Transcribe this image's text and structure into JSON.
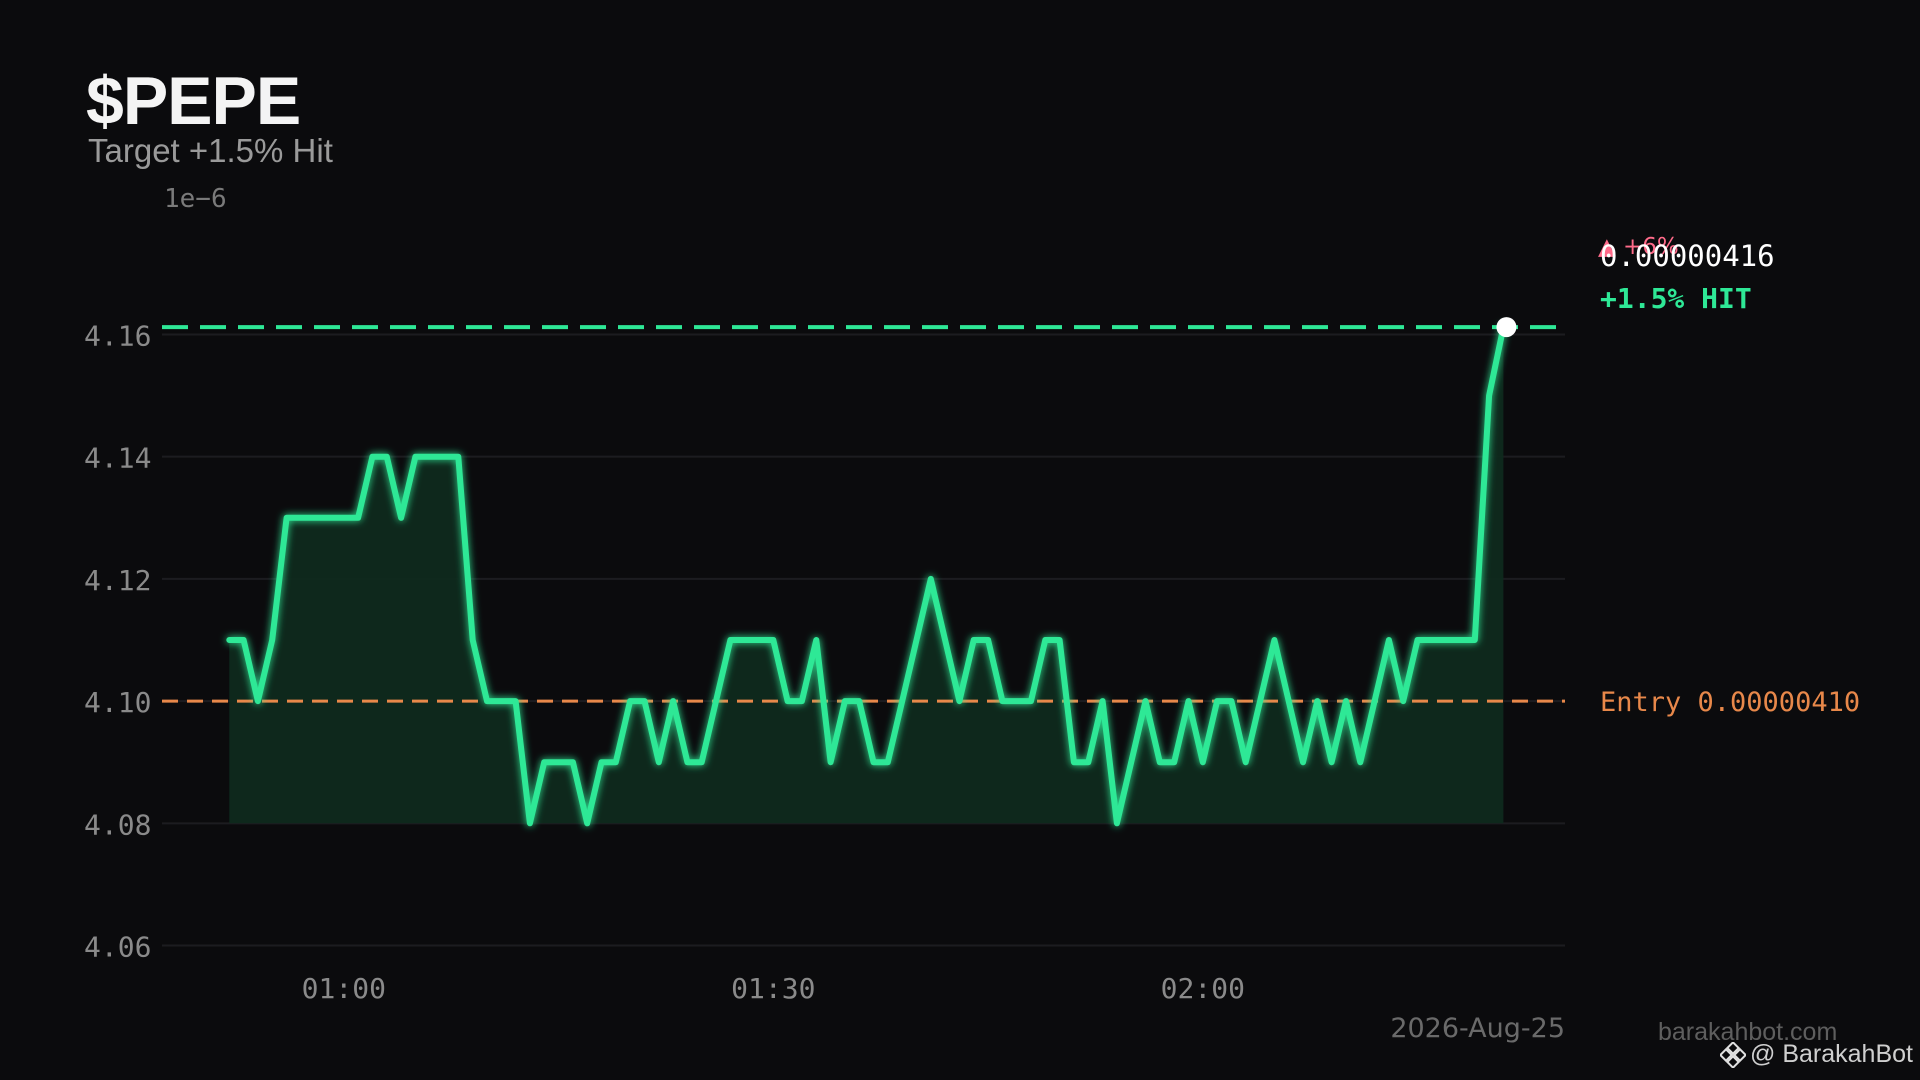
{
  "header": {
    "title": "$PEPE",
    "subtitle": "Target +1.5% Hit"
  },
  "watermark": {
    "site": "barakahbot.com",
    "handle": "@ BarakahBot",
    "icon": "binance-diamond-icon"
  },
  "colors": {
    "background": "#0b0b0d",
    "line": "#2ee896",
    "fill": "#0f2a1e",
    "target": "#2ee896",
    "entry": "#e8884a",
    "up": "#ff6b8a",
    "tick": "#8a8a8a",
    "grid": "#1c1c20"
  },
  "chart_data": {
    "type": "area",
    "scale_label": "1e−6",
    "yticks": [
      "4.06",
      "4.08",
      "4.10",
      "4.12",
      "4.14",
      "4.16"
    ],
    "ylim": [
      4.056,
      4.182
    ],
    "xticks": [
      {
        "label": "01:00",
        "x": 60
      },
      {
        "label": "01:30",
        "x": 90
      },
      {
        "label": "02:00",
        "x": 120
      }
    ],
    "xlim": [
      47.3,
      145.3
    ],
    "date_label": "2026-Aug-25",
    "grid": true,
    "x": [
      52,
      53,
      54,
      55,
      56,
      57,
      58,
      59,
      60,
      61,
      62,
      63,
      64,
      65,
      66,
      67,
      68,
      69,
      70,
      71,
      72,
      73,
      74,
      75,
      76,
      77,
      78,
      79,
      80,
      81,
      82,
      83,
      84,
      85,
      86,
      87,
      88,
      89,
      90,
      91,
      92,
      93,
      94,
      95,
      96,
      97,
      98,
      99,
      100,
      101,
      102,
      103,
      104,
      105,
      106,
      107,
      108,
      109,
      110,
      111,
      112,
      113,
      114,
      115,
      116,
      117,
      118,
      119,
      120,
      121,
      122,
      123,
      124,
      125,
      126,
      127,
      128,
      129,
      130,
      131,
      132,
      133,
      134,
      135,
      136,
      137,
      138,
      139,
      140,
      141
    ],
    "y": [
      4.11,
      4.11,
      4.1,
      4.11,
      4.13,
      4.13,
      4.13,
      4.13,
      4.13,
      4.13,
      4.14,
      4.14,
      4.13,
      4.14,
      4.14,
      4.14,
      4.14,
      4.11,
      4.1,
      4.1,
      4.1,
      4.08,
      4.09,
      4.09,
      4.09,
      4.08,
      4.09,
      4.09,
      4.1,
      4.1,
      4.09,
      4.1,
      4.09,
      4.09,
      4.1,
      4.11,
      4.11,
      4.11,
      4.11,
      4.1,
      4.1,
      4.11,
      4.09,
      4.1,
      4.1,
      4.09,
      4.09,
      4.1,
      4.11,
      4.12,
      4.11,
      4.1,
      4.11,
      4.11,
      4.1,
      4.1,
      4.1,
      4.11,
      4.11,
      4.09,
      4.09,
      4.1,
      4.08,
      4.09,
      4.1,
      4.09,
      4.09,
      4.1,
      4.09,
      4.1,
      4.1,
      4.09,
      4.1,
      4.11,
      4.1,
      4.09,
      4.1,
      4.09,
      4.1,
      4.09,
      4.1,
      4.11,
      4.1,
      4.11,
      4.11,
      4.11,
      4.11,
      4.11,
      4.15,
      4.1612
    ],
    "fill_base": 4.08,
    "target": {
      "value": 4.1612,
      "label": "+1.5%  HIT",
      "price": "0.00000416",
      "badge": "▲ +6%"
    },
    "entry": {
      "value": 4.1,
      "label": "Entry 0.00000410"
    }
  }
}
